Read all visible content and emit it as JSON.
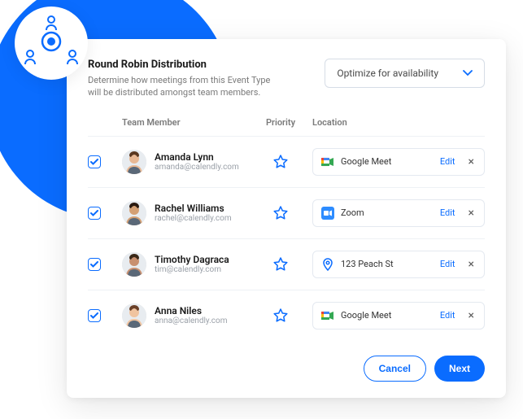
{
  "header": {
    "title": "Round Robin Distribution",
    "description": "Determine how meetings from this Event Type will be distributed amongst team members.",
    "dropdown_label": "Optimize for availability"
  },
  "columns": {
    "member": "Team Member",
    "priority": "Priority",
    "location": "Location"
  },
  "rows": [
    {
      "name": "Amanda Lynn",
      "email": "amanda@calendly.com",
      "location_type": "google-meet",
      "location_label": "Google Meet",
      "edit": "Edit"
    },
    {
      "name": "Rachel Williams",
      "email": "rachel@calendly.com",
      "location_type": "zoom",
      "location_label": "Zoom",
      "edit": "Edit"
    },
    {
      "name": "Timothy Dagraca",
      "email": "tim@calendly.com",
      "location_type": "pin",
      "location_label": "123 Peach St",
      "edit": "Edit"
    },
    {
      "name": "Anna Niles",
      "email": "anna@calendly.com",
      "location_type": "google-meet",
      "location_label": "Google Meet",
      "edit": "Edit"
    }
  ],
  "footer": {
    "cancel": "Cancel",
    "next": "Next"
  },
  "icons": {
    "google_meet_colors": [
      "#34a853",
      "#fbbc05",
      "#ea4335",
      "#4285f4"
    ],
    "zoom_color": "#2d8cff",
    "pin_color": "#0a6cff"
  }
}
